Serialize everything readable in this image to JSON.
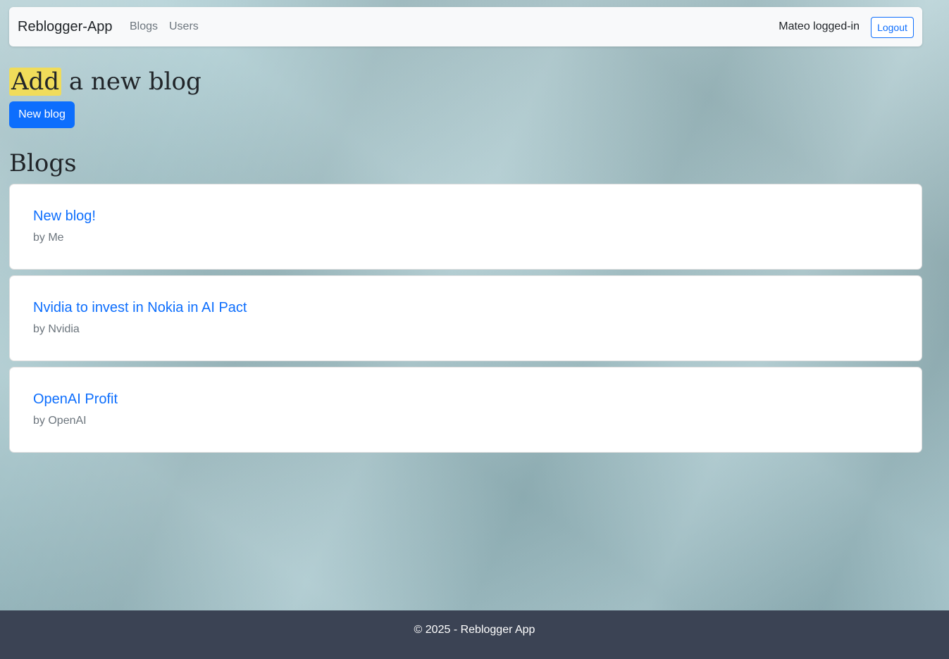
{
  "navbar": {
    "brand": "Reblogger-App",
    "links": [
      {
        "label": "Blogs"
      },
      {
        "label": "Users"
      }
    ],
    "user_status": "Mateo logged-in",
    "logout_label": "Logout"
  },
  "add_section": {
    "heading_highlight": "Add",
    "heading_rest": " a new blog",
    "new_blog_button": "New blog"
  },
  "blogs_section": {
    "heading": "Blogs",
    "items": [
      {
        "title": "New blog!",
        "author": "by Me"
      },
      {
        "title": "Nvidia to invest in Nokia in AI Pact",
        "author": "by Nvidia"
      },
      {
        "title": "OpenAI Profit",
        "author": "by OpenAI"
      }
    ]
  },
  "footer": {
    "text": "© 2025 - Reblogger App"
  },
  "colors": {
    "primary": "#0d6efd",
    "highlight": "#f0dc5a",
    "footer_bg": "#3b4354",
    "navbar_bg": "#f8f9fa"
  }
}
